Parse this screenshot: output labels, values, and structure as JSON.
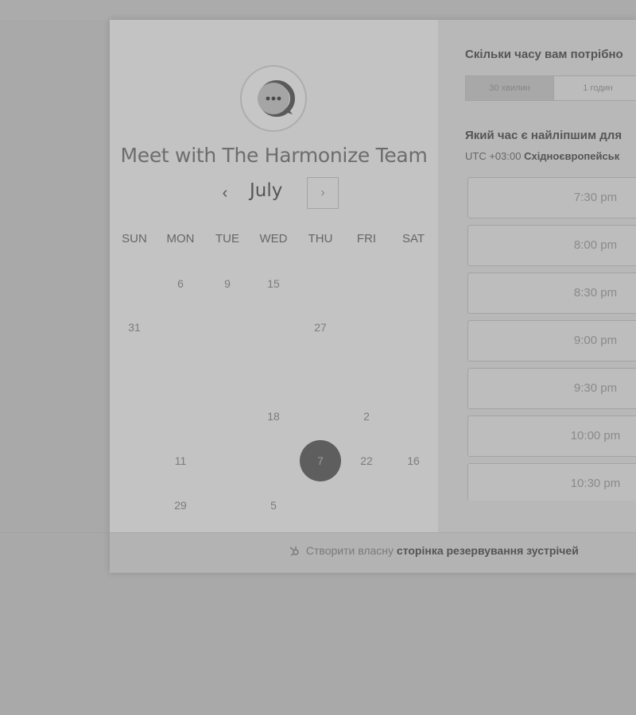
{
  "header": {
    "title": "Meet with The Harmonize Team"
  },
  "calendar": {
    "month": "July",
    "prev_icon": "chevron-left-icon",
    "next_icon": "chevron-right-icon",
    "weekdays": [
      "SUN",
      "MON",
      "TUE",
      "WED",
      "THU",
      "FRI",
      "SAT"
    ],
    "days": [
      {
        "label": "6",
        "col": 1,
        "row": 0
      },
      {
        "label": "9",
        "col": 2,
        "row": 0
      },
      {
        "label": "15",
        "col": 3,
        "row": 0
      },
      {
        "label": "31",
        "col": 0,
        "row": 1
      },
      {
        "label": "27",
        "col": 4,
        "row": 1
      },
      {
        "label": "18",
        "col": 3,
        "row": 3
      },
      {
        "label": "2",
        "col": 5,
        "row": 3
      },
      {
        "label": "11",
        "col": 1,
        "row": 4
      },
      {
        "label": "7",
        "col": 4,
        "row": 4,
        "selected": true
      },
      {
        "label": "22",
        "col": 5,
        "row": 4
      },
      {
        "label": "16",
        "col": 6,
        "row": 4
      },
      {
        "label": "29",
        "col": 1,
        "row": 5
      },
      {
        "label": "5",
        "col": 3,
        "row": 5
      }
    ]
  },
  "scheduler": {
    "duration_question": "Скільки часу вам потрібно",
    "durations": [
      {
        "label": "30 хвилин",
        "active": true
      },
      {
        "label": "1 годин",
        "active": false
      }
    ],
    "time_question": "Який час є найліпшим для",
    "timezone_offset": "UTC +03:00",
    "timezone_name": "Східноєвропейськ",
    "slots": [
      "7:30 pm",
      "8:00 pm",
      "8:30 pm",
      "9:00 pm",
      "9:30 pm",
      "10:00 pm",
      "10:30 pm"
    ]
  },
  "footer": {
    "icon": "hubspot-sprocket-icon",
    "prefix": "Створити власну",
    "link": "сторінка резервування зустрічей"
  },
  "colors": {
    "selected_day": "#5e5e5e",
    "background": "#a9a9a9"
  }
}
